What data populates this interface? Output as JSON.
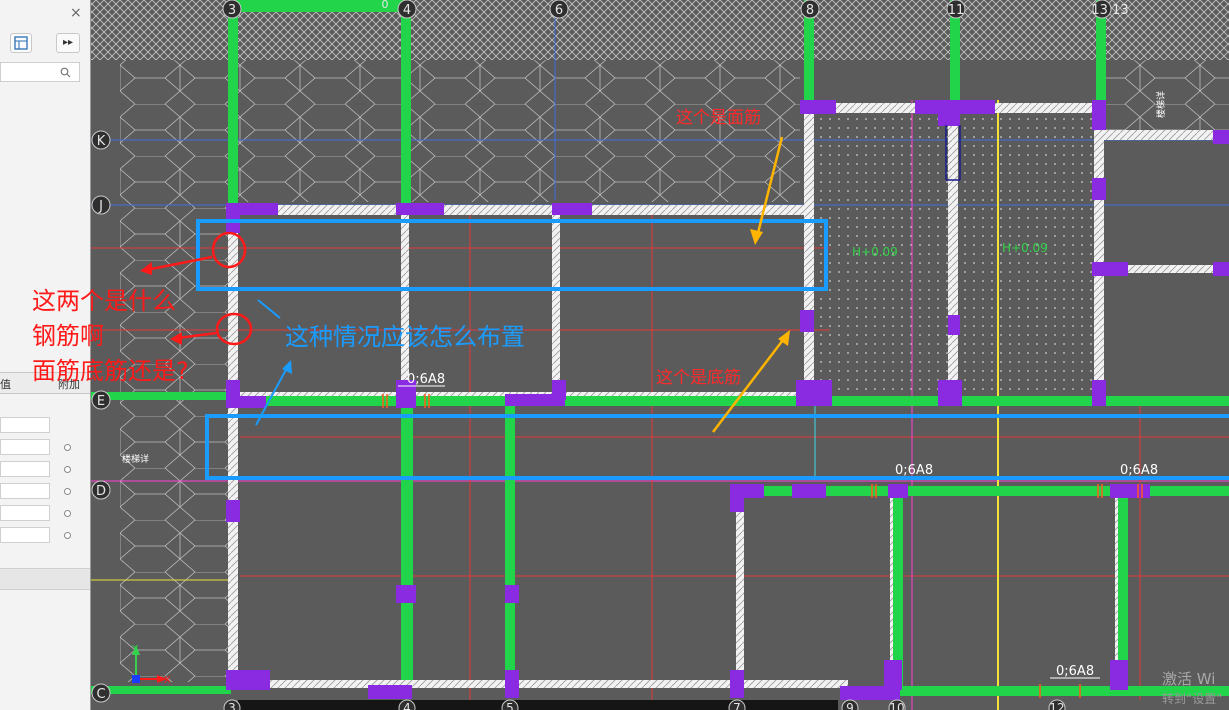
{
  "panel": {
    "close_glyph": "×",
    "expand_glyph": "▸▸",
    "col_value": "值",
    "col_extra": "附加"
  },
  "grid": {
    "top_axes": [
      "3",
      "4",
      "6",
      "8",
      "11",
      "13 13"
    ],
    "top_small": "0",
    "bottom_axes": [
      "3",
      "4",
      "5",
      "7",
      "9",
      "10",
      "12"
    ],
    "left_axes": [
      "K",
      "J",
      "E",
      "D",
      "C"
    ]
  },
  "labels": {
    "stirrup": "0;6A8",
    "elev": "H+0.09",
    "stair": "楼梯详"
  },
  "annotations": {
    "question_lines": [
      "这两个是什么",
      "钢筋啊",
      "面筋底筋还是?"
    ],
    "layout_question": "这种情况应该怎么布置",
    "top_rebar": "这个是面筋",
    "bottom_rebar": "这个是底筋"
  },
  "axis_indicator": {
    "y": "Y",
    "x": "X"
  },
  "watermark": {
    "line1": "激活 Wi",
    "line2": "转到“设置”"
  },
  "colors": {
    "canvas_bg": "#5b5b5b",
    "beam_green": "#22d44a",
    "column_purple": "#8a2be2",
    "highlight_blue": "#1a9cff",
    "annotation_red": "#ff1a1a",
    "annotation_orange": "#ffb400"
  }
}
